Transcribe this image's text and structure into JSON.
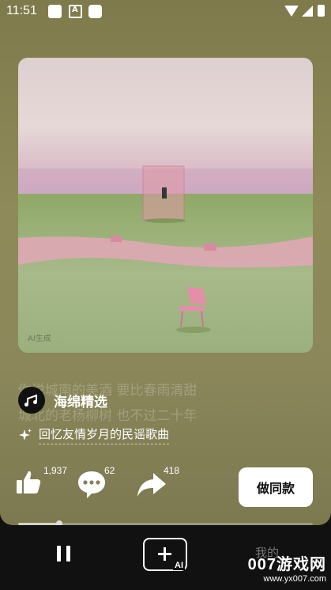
{
  "status_bar": {
    "time": "11:51"
  },
  "artwork": {
    "watermark": "AI生成"
  },
  "lyrics": [
    "你说城南的美酒 要比春雨清甜",
    "城北的老杨柳树 也不过二十年"
  ],
  "channel": {
    "name": "海绵精选"
  },
  "song": {
    "title": "回忆友情岁月的民谣歌曲"
  },
  "actions": {
    "like_count": "1,937",
    "comment_count": "62",
    "share_count": "418",
    "make_same_label": "做同款"
  },
  "playback": {
    "progress": 0.14
  },
  "bottom_nav": {
    "create_ai_label": "AI",
    "mine_label": "我的"
  },
  "site_watermark": {
    "title": "007游戏网",
    "url": "www.yx007.com"
  },
  "colors": {
    "background": "#8b875b",
    "accent": "#ffffff",
    "nav_bg": "#111111"
  }
}
